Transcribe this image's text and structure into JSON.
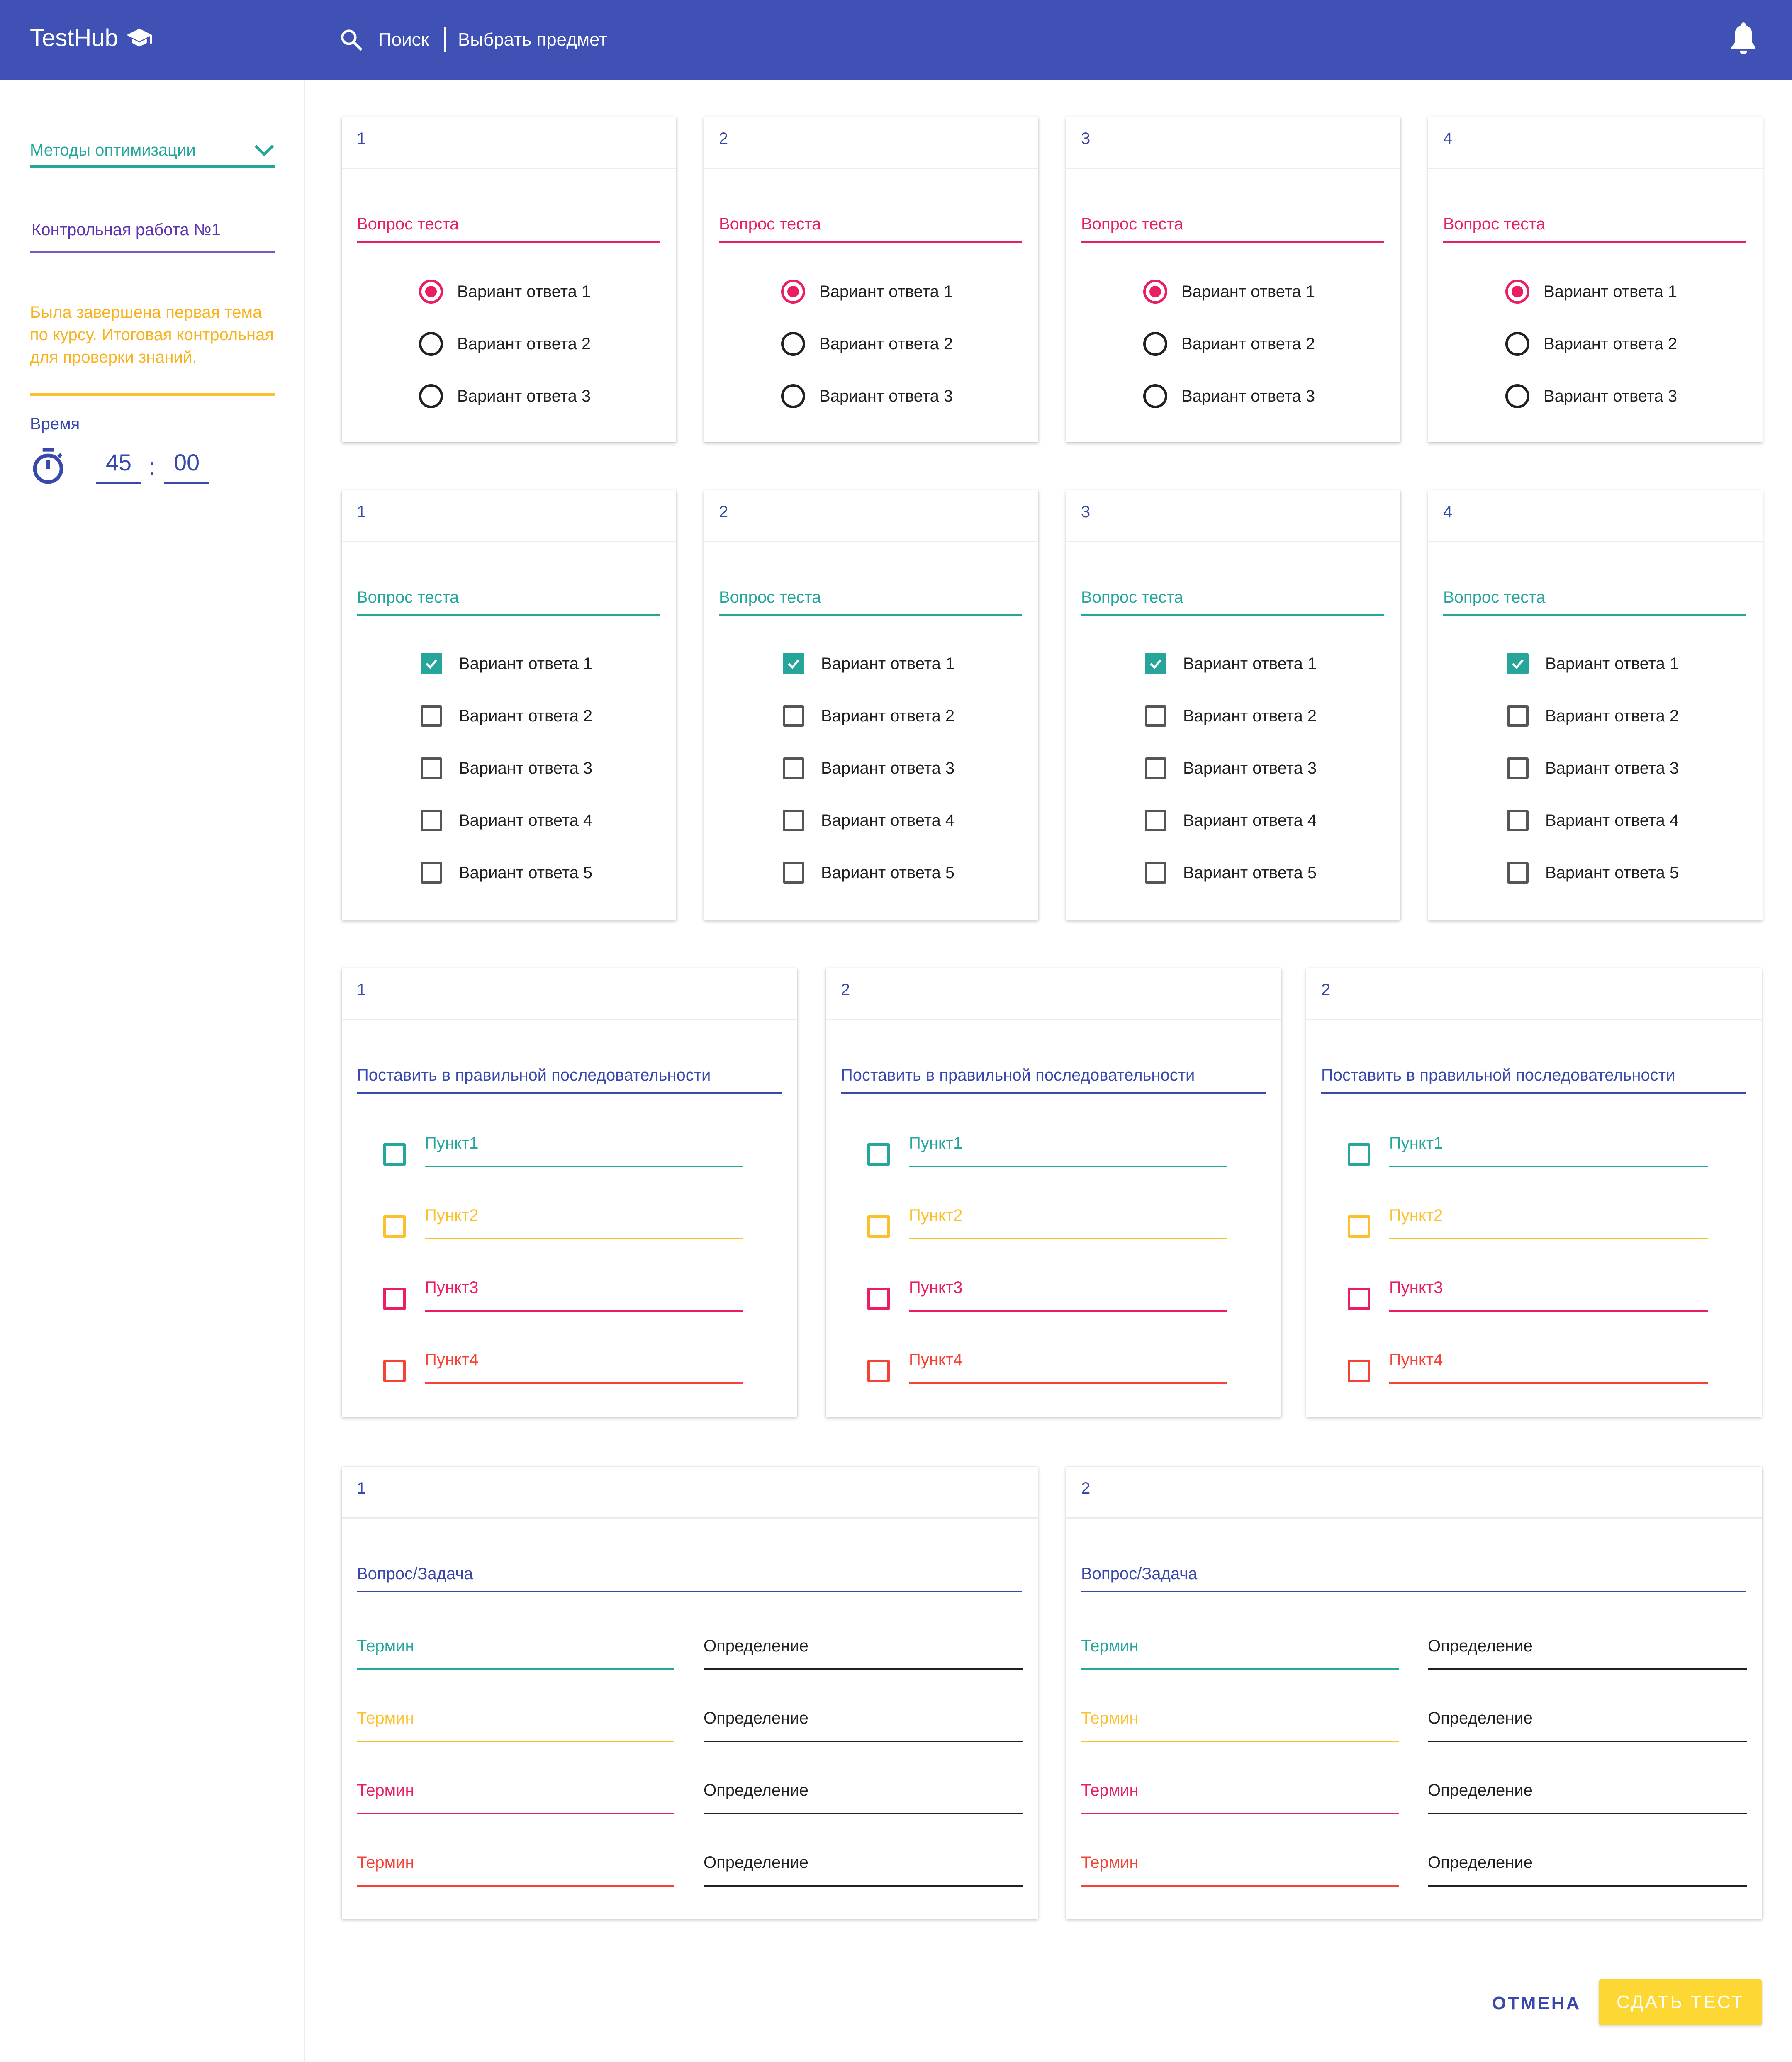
{
  "app": {
    "title": "TestHub",
    "search_label": "Поиск",
    "subject_label": "Выбрать предмет"
  },
  "sidebar": {
    "course": "Методы оптимизации",
    "work_name": "Контрольная работа №1",
    "description": "Была завершена первая тема по курсу. Итоговая контрольная для проверки знаний.",
    "time_label": "Время",
    "minutes": "45",
    "colon": ":",
    "seconds": "00"
  },
  "single_choice": [
    {
      "num": "1",
      "question": "Вопрос теста",
      "options": [
        "Вариант ответа 1",
        "Вариант ответа 2",
        "Вариант ответа 3"
      ],
      "selected": 0
    },
    {
      "num": "2",
      "question": "Вопрос теста",
      "options": [
        "Вариант ответа 1",
        "Вариант ответа 2",
        "Вариант ответа 3"
      ],
      "selected": 0
    },
    {
      "num": "3",
      "question": "Вопрос теста",
      "options": [
        "Вариант ответа 1",
        "Вариант ответа 2",
        "Вариант ответа 3"
      ],
      "selected": 0
    },
    {
      "num": "4",
      "question": "Вопрос теста",
      "options": [
        "Вариант ответа 1",
        "Вариант ответа 2",
        "Вариант ответа 3"
      ],
      "selected": 0
    }
  ],
  "multi_choice": [
    {
      "num": "1",
      "question": "Вопрос теста",
      "options": [
        "Вариант ответа 1",
        "Вариант ответа 2",
        "Вариант ответа 3",
        "Вариант ответа 4",
        "Вариант ответа 5"
      ],
      "checked": [
        true,
        false,
        false,
        false,
        false
      ]
    },
    {
      "num": "2",
      "question": "Вопрос теста",
      "options": [
        "Вариант ответа 1",
        "Вариант ответа 2",
        "Вариант ответа 3",
        "Вариант ответа 4",
        "Вариант ответа 5"
      ],
      "checked": [
        true,
        false,
        false,
        false,
        false
      ]
    },
    {
      "num": "3",
      "question": "Вопрос теста",
      "options": [
        "Вариант ответа 1",
        "Вариант ответа 2",
        "Вариант ответа 3",
        "Вариант ответа 4",
        "Вариант ответа 5"
      ],
      "checked": [
        true,
        false,
        false,
        false,
        false
      ]
    },
    {
      "num": "4",
      "question": "Вопрос теста",
      "options": [
        "Вариант ответа 1",
        "Вариант ответа 2",
        "Вариант ответа 3",
        "Вариант ответа 4",
        "Вариант ответа 5"
      ],
      "checked": [
        true,
        false,
        false,
        false,
        false
      ]
    }
  ],
  "sequence": [
    {
      "num": "1",
      "question": "Поставить в правильной последовательности",
      "items": [
        "Пункт1",
        "Пункт2",
        "Пункт3",
        "Пункт4"
      ]
    },
    {
      "num": "2",
      "question": "Поставить в правильной последовательности",
      "items": [
        "Пункт1",
        "Пункт2",
        "Пункт3",
        "Пункт4"
      ]
    },
    {
      "num": "2",
      "question": "Поставить в правильной последовательности",
      "items": [
        "Пункт1",
        "Пункт2",
        "Пункт3",
        "Пункт4"
      ]
    }
  ],
  "matching": [
    {
      "num": "1",
      "question": "Вопрос/Задача",
      "pairs": [
        {
          "term": "Термин",
          "definition": "Определение"
        },
        {
          "term": "Термин",
          "definition": "Определение"
        },
        {
          "term": "Термин",
          "definition": "Определение"
        },
        {
          "term": "Термин",
          "definition": "Определение"
        }
      ]
    },
    {
      "num": "2",
      "question": "Вопрос/Задача",
      "pairs": [
        {
          "term": "Термин",
          "definition": "Определение"
        },
        {
          "term": "Термин",
          "definition": "Определение"
        },
        {
          "term": "Термин",
          "definition": "Определение"
        },
        {
          "term": "Термин",
          "definition": "Определение"
        }
      ]
    }
  ],
  "row_colors": [
    "#26a69a",
    "#fbc02d",
    "#e91e63",
    "#f44336"
  ],
  "actions": {
    "cancel": "ОТМЕНА",
    "submit": "СДАТЬ ТЕСТ"
  },
  "icons": {
    "brand": "graduation-cap-icon",
    "search": "search-icon",
    "notifications": "bell-icon",
    "dropdown": "chevron-down-icon",
    "timer": "timer-icon"
  }
}
